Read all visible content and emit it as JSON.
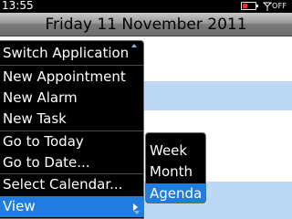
{
  "status_bar": {
    "time": "13:55",
    "battery_icon": "battery-low-icon",
    "battery_level": 0.35,
    "battery_color": "#e53030",
    "signal_icon": "antenna-off-icon",
    "signal_label": "OFF"
  },
  "header": {
    "date": "Friday 11 November 2011"
  },
  "menu": {
    "items": [
      {
        "label": "Switch Application"
      },
      {
        "label": "New Appointment"
      },
      {
        "label": "New Alarm"
      },
      {
        "label": "New Task"
      },
      {
        "label": "Go to Today"
      },
      {
        "label": "Go to Date..."
      },
      {
        "label": "Select Calendar..."
      },
      {
        "label": "View"
      }
    ],
    "selected": "View",
    "highlight_color": "#1f7de0"
  },
  "submenu": {
    "items": [
      {
        "label": "Week"
      },
      {
        "label": "Month"
      },
      {
        "label": "Agenda"
      }
    ],
    "selected": "Agenda"
  },
  "colors": {
    "calendar_band": "#bcd8f5",
    "menu_background": "#000000"
  }
}
